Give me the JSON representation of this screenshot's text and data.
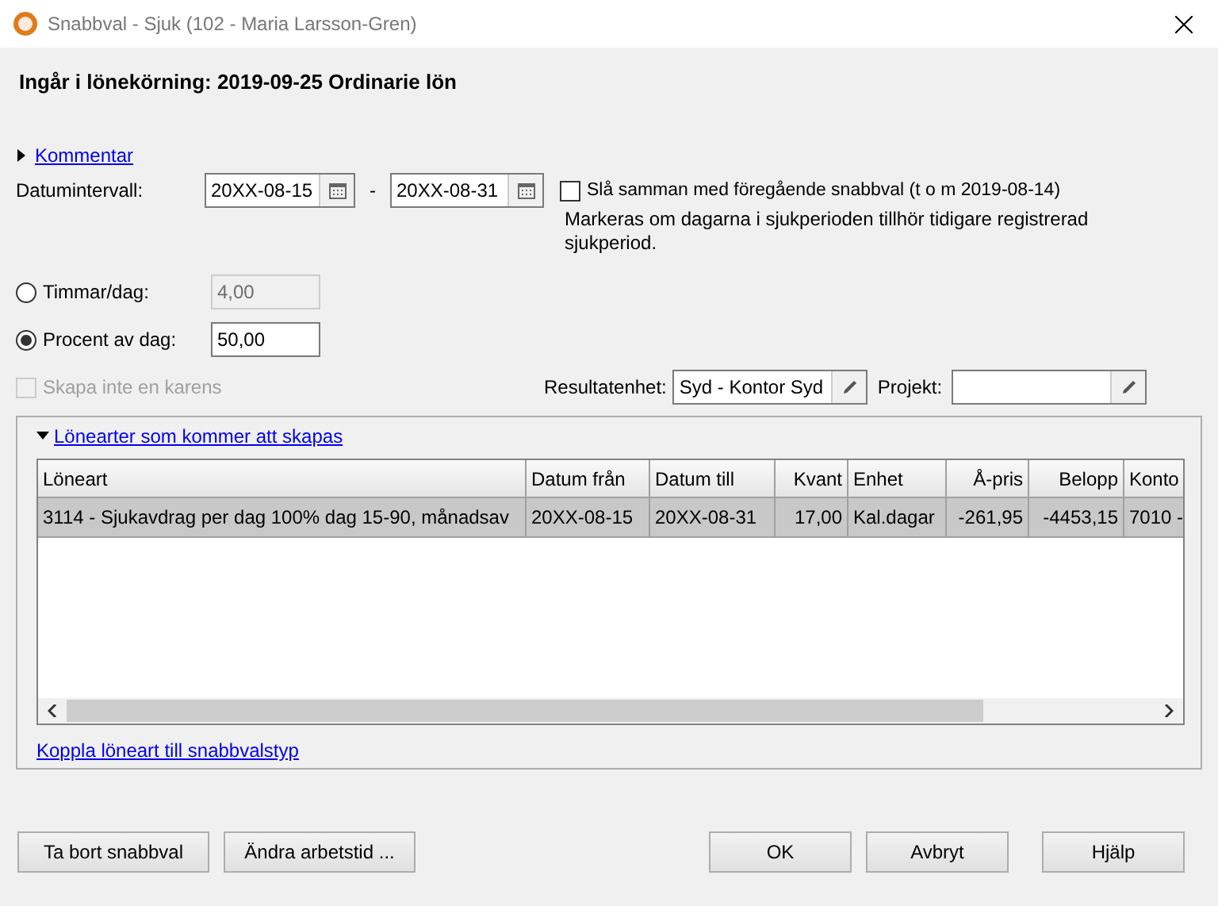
{
  "window": {
    "title": "Snabbval - Sjuk (102 - Maria Larsson-Gren)"
  },
  "heading": "Ingår i lönekörning: 2019-09-25 Ordinarie lön",
  "comment": {
    "label": "Kommentar",
    "expanded": false
  },
  "date_range": {
    "label": "Datumintervall:",
    "from": "20XX-08-15",
    "separator": "-",
    "to": "20XX-08-31"
  },
  "merge": {
    "label": "Slå samman med föregående snabbval (t o m 2019-08-14)",
    "checked": false,
    "hint": "Markeras om dagarna i sjukperioden tillhör tidigare registrerad sjukperiod."
  },
  "amount_options": [
    {
      "label": "Timmar/dag:",
      "value": "4,00",
      "selected": false
    },
    {
      "label": "Procent av dag:",
      "value": "50,00",
      "selected": true
    }
  ],
  "no_waiting_day": {
    "label": "Skapa inte en karens",
    "checked": false,
    "disabled": true
  },
  "result_unit": {
    "label": "Resultatenhet:",
    "value": "Syd - Kontor Syd"
  },
  "project": {
    "label": "Projekt:"
  },
  "salary_types": {
    "label": "Lönearter som kommer att skapas",
    "expanded": true,
    "columns": [
      {
        "label": "Löneart",
        "kind": "text"
      },
      {
        "label": "Datum från",
        "kind": "text"
      },
      {
        "label": "Datum till",
        "kind": "text"
      },
      {
        "label": "Kvant",
        "kind": "number"
      },
      {
        "label": "Enhet",
        "kind": "text"
      },
      {
        "label": "Å-pris",
        "kind": "number"
      },
      {
        "label": "Belopp",
        "kind": "number"
      },
      {
        "label": "Konto",
        "kind": "text"
      }
    ],
    "rows": [
      {
        "selected": true,
        "cells": [
          "3114 - Sjukavdrag per dag 100% dag 15-90, månadsav",
          "20XX-08-15",
          "20XX-08-31",
          "17,00",
          "Kal.dagar",
          "-261,95",
          "-4453,15",
          "7010 -"
        ]
      }
    ],
    "link": "Koppla löneart till snabbvalstyp"
  },
  "buttons_left": [
    "Ta bort snabbval",
    "Ändra arbetstid ..."
  ],
  "buttons_right": [
    "OK",
    "Avbryt",
    "Hjälp"
  ]
}
